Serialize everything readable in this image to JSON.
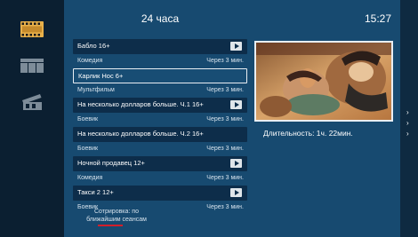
{
  "header": {
    "title": "24 часа",
    "clock": "15:27"
  },
  "sidebar": {
    "items": [
      {
        "icon": "film-strip-icon",
        "active": true
      },
      {
        "icon": "tile-grid-icon",
        "active": false
      },
      {
        "icon": "clapperboard-icon",
        "active": false
      }
    ]
  },
  "movies": [
    {
      "title": "Бабло 16+",
      "genre": "Комедия",
      "time": "Через 3 мин."
    },
    {
      "title": "Карлик Нос 6+",
      "genre": "Мультфильм",
      "time": "Через 3 мин."
    },
    {
      "title": "На несколько долларов больше. Ч.1 16+",
      "genre": "Боевик",
      "time": "Через 3 мин."
    },
    {
      "title": "На несколько долларов больше. Ч.2 16+",
      "genre": "Боевик",
      "time": "Через 3 мин."
    },
    {
      "title": "Ночной продавец 12+",
      "genre": "Комедия",
      "time": "Через 3 мин."
    },
    {
      "title": "Такси 2 12+",
      "genre": "Боевик",
      "time": "Через 3 мин."
    }
  ],
  "selected_index": 1,
  "sort": {
    "label": "Сотрировка: по ближайшим сеансам"
  },
  "details": {
    "duration": "Длительность: 1ч. 22мин."
  },
  "colors": {
    "panel": "#174a70",
    "row": "#0d2d4a",
    "sidebar": "#0b1f31",
    "accent": "#d31f2a",
    "icon_active": "#e8b04a"
  }
}
